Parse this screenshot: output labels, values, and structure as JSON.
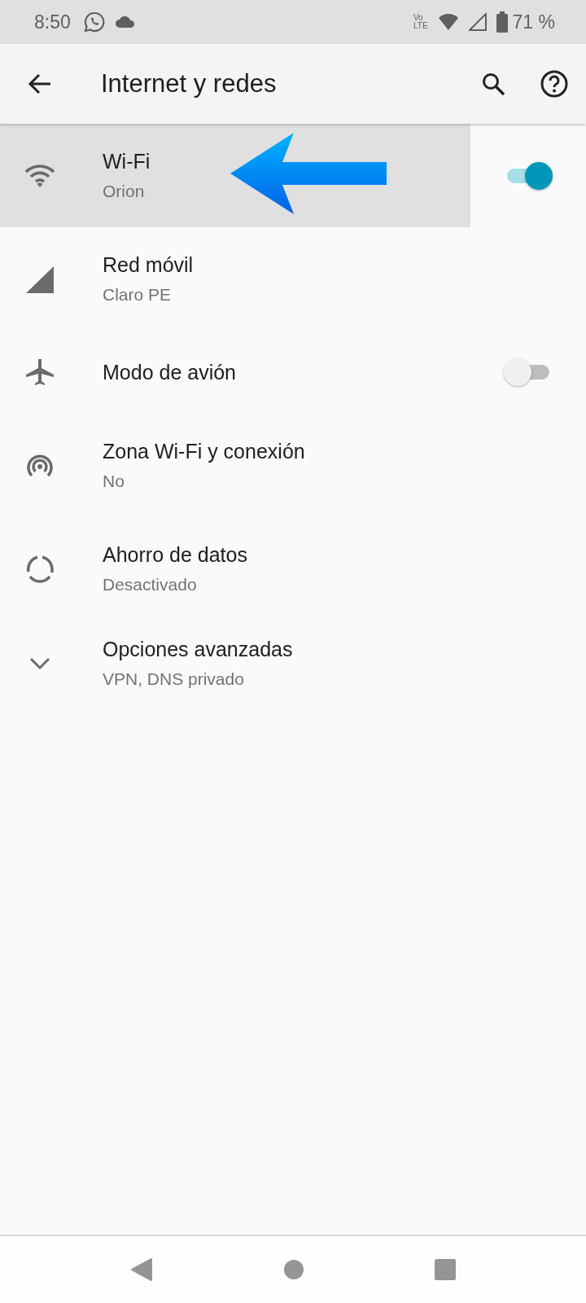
{
  "status_bar": {
    "time": "8:50",
    "volte_top": "Vo",
    "volte_bottom": "LTE",
    "battery": "71 %"
  },
  "app_bar": {
    "title": "Internet y redes"
  },
  "items": [
    {
      "kind": "wifi",
      "title": "Wi-Fi",
      "subtitle": "Orion",
      "selected": true,
      "on": true
    },
    {
      "kind": "signal",
      "title": "Red móvil",
      "subtitle": "Claro PE",
      "selected": false
    },
    {
      "kind": "airplane",
      "title": "Modo de avión",
      "selected": false,
      "on": false
    },
    {
      "kind": "hotspot",
      "title": "Zona Wi-Fi y conexión",
      "subtitle": "No",
      "selected": false
    },
    {
      "kind": "datasaver",
      "title": "Ahorro de datos",
      "subtitle": "Desactivado",
      "selected": false
    },
    {
      "kind": "expand",
      "title": "Opciones avanzadas",
      "subtitle": "VPN, DNS privado",
      "selected": false
    }
  ]
}
